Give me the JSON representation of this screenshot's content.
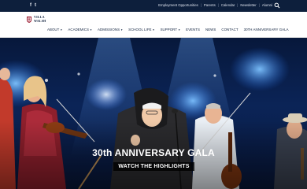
{
  "topbar": {
    "social": [
      {
        "icon": "facebook-icon",
        "glyph": "f"
      },
      {
        "icon": "twitter-icon",
        "glyph": "t"
      }
    ],
    "links": [
      "Employment Opportunities",
      "Parents",
      "Calendar",
      "Newsletter",
      "Alumni"
    ],
    "search_icon": "search-icon"
  },
  "header": {
    "logo_line1": "VILLA",
    "logo_line2": "WALSH",
    "nav": [
      {
        "label": "ABOUT",
        "dropdown": true
      },
      {
        "label": "ACADEMICS",
        "dropdown": true
      },
      {
        "label": "ADMISSIONS",
        "dropdown": true
      },
      {
        "label": "SCHOOL LIFE",
        "dropdown": true
      },
      {
        "label": "SUPPORT",
        "dropdown": true
      },
      {
        "label": "EVENTS",
        "dropdown": false
      },
      {
        "label": "NEWS",
        "dropdown": false
      },
      {
        "label": "CONTACT",
        "dropdown": false
      },
      {
        "label": "30TH ANNIVERSARY GALA",
        "dropdown": false
      }
    ]
  },
  "hero": {
    "title": "30th ANNIVERSARY GALA",
    "cta": "WATCH THE HIGHLIGHTS"
  },
  "colors": {
    "navy": "#0d1f3c",
    "accent_red": "#9b1b30",
    "hero_blue": "#0b2457"
  }
}
